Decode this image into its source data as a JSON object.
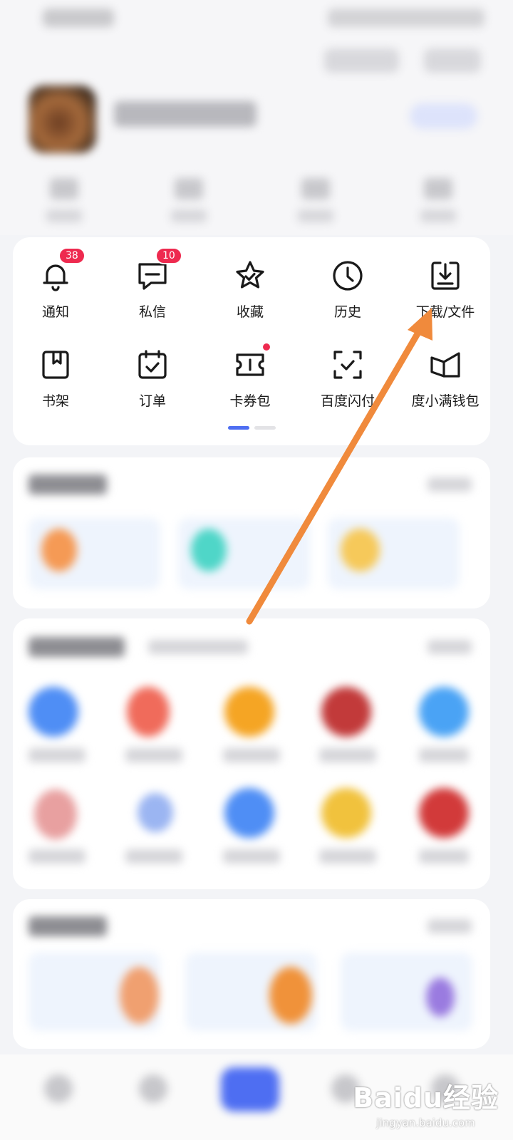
{
  "quick_actions": [
    {
      "label": "通知",
      "icon": "bell-icon",
      "badge": "38"
    },
    {
      "label": "私信",
      "icon": "message-icon",
      "badge": "10"
    },
    {
      "label": "收藏",
      "icon": "star-icon"
    },
    {
      "label": "历史",
      "icon": "clock-icon"
    },
    {
      "label": "下载/文件",
      "icon": "download-icon"
    },
    {
      "label": "书架",
      "icon": "bookshelf-icon"
    },
    {
      "label": "订单",
      "icon": "order-icon"
    },
    {
      "label": "卡券包",
      "icon": "ticket-icon",
      "dot": true
    },
    {
      "label": "百度闪付",
      "icon": "scan-pay-icon"
    },
    {
      "label": "度小满钱包",
      "icon": "wallet-icon"
    }
  ],
  "pager": {
    "pages": 2,
    "active": 1
  },
  "colors": {
    "badge": "#ee2a4f",
    "accent": "#4e6ef2",
    "annotation_arrow": "#f08a3c"
  },
  "watermark": {
    "logo": "Baidu经验",
    "sub": "jingyan.baidu.com"
  }
}
